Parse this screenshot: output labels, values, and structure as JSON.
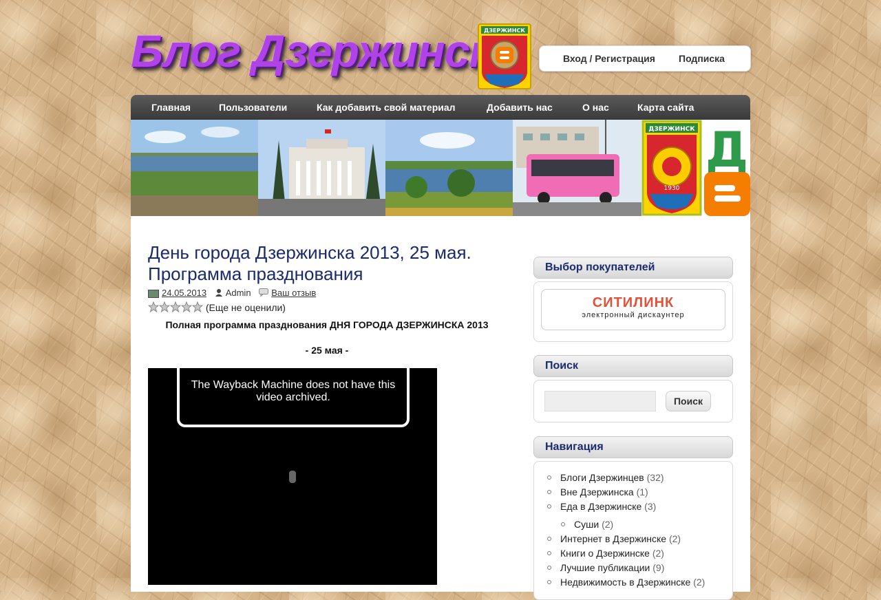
{
  "header": {
    "logo_text": "Блог Дзержинска",
    "emblem_label": "ДЗЕРЖИНСК",
    "login_label": "Вход / Регистрация",
    "subscribe_label": "Подписка"
  },
  "nav": {
    "items": [
      "Главная",
      "Пользователи",
      "Как добавить свой материал",
      "Добавить нас",
      "О нас",
      "Карта сайта"
    ]
  },
  "banner": {
    "emblem_label": "ДЗЕРЖИНСК",
    "emblem_year": "1930",
    "letter": "Д"
  },
  "post": {
    "title": "День города Дзержинска 2013, 25 мая. Программа празднования",
    "date": "24.05.2013",
    "author": "Admin",
    "review_link": "Ваш отзыв",
    "rating_text": "(Еще не оценили)",
    "intro": "Полная программа празднования ДНЯ ГОРОДА ДЗЕРЖИНСКА 2013",
    "day": "- 25 мая -",
    "video_message": "The Wayback Machine does not have this video archived."
  },
  "sidebar": {
    "buyers_choice": {
      "title": "Выбор покупателей",
      "ad_brand": "СИТИЛИНК",
      "ad_tagline": "электронный дискаунтер"
    },
    "search": {
      "title": "Поиск",
      "button_label": "Поиск",
      "input_value": ""
    },
    "navigation": {
      "title": "Навигация",
      "items": [
        {
          "label": "Блоги Дзержинцев",
          "count": "(32)"
        },
        {
          "label": "Вне Дзержинска",
          "count": "(1)"
        },
        {
          "label": "Еда в Дзержинске",
          "count": "(3)"
        },
        {
          "label": "Суши",
          "count": "(2)"
        },
        {
          "label": "Интернет в Дзержинске",
          "count": "(2)"
        },
        {
          "label": "Книги о Дзержинске",
          "count": "(2)"
        },
        {
          "label": "Лучшие публикации",
          "count": "(9)"
        },
        {
          "label": "Недвижимость в Дзержинске",
          "count": "(2)"
        }
      ]
    }
  },
  "colors": {
    "title_blue": "#1a2a6e",
    "logo_purple": "#b043e8",
    "nav_bg": "#4a4a4a",
    "ad_red": "#e0533a",
    "blogger_orange": "#f57d00"
  }
}
